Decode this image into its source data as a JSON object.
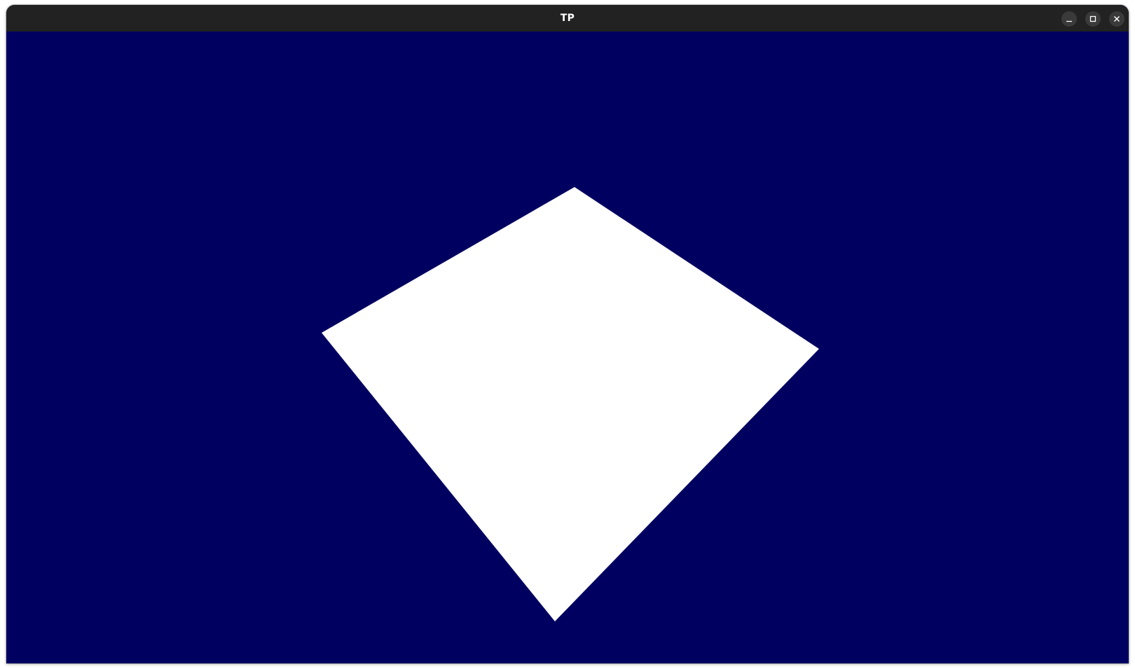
{
  "window": {
    "title": "TP",
    "controls": {
      "minimize_icon": "minimize-icon",
      "maximize_icon": "maximize-icon",
      "close_icon": "close-icon"
    }
  },
  "scene": {
    "background_color": "#000060",
    "shape_color": "#ffffff",
    "shape": "quad"
  }
}
